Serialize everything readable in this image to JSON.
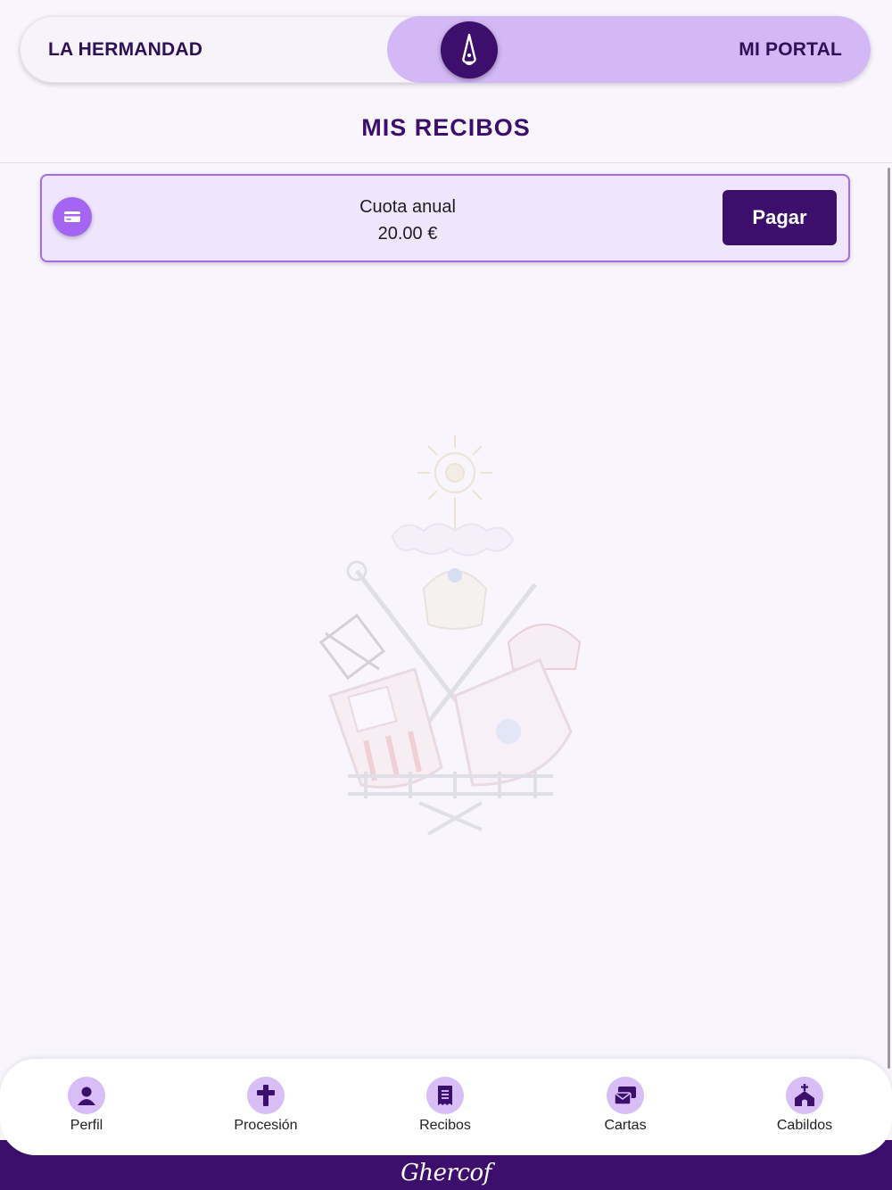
{
  "header": {
    "toggle_left_label": "LA HERMANDAD",
    "toggle_right_label": "MI PORTAL",
    "active": "MI PORTAL"
  },
  "page": {
    "title": "MIS RECIBOS"
  },
  "receipts": [
    {
      "concept": "Cuota anual",
      "amount": "20.00 €",
      "action_label": "Pagar",
      "icon": "credit-card-icon"
    }
  ],
  "bottom_nav": {
    "items": [
      {
        "label": "Perfil",
        "icon": "person-icon"
      },
      {
        "label": "Procesión",
        "icon": "cross-icon"
      },
      {
        "label": "Recibos",
        "icon": "receipt-icon"
      },
      {
        "label": "Cartas",
        "icon": "letters-icon"
      },
      {
        "label": "Cabildos",
        "icon": "chapel-icon"
      }
    ]
  },
  "footer": {
    "logo_text": "Ghercof"
  },
  "colors": {
    "primary": "#3b0f6b",
    "accent": "#a466f2",
    "toggle_active_bg": "#d4b8f5",
    "card_bg": "#efe5fc",
    "background": "#f8f5fd"
  }
}
